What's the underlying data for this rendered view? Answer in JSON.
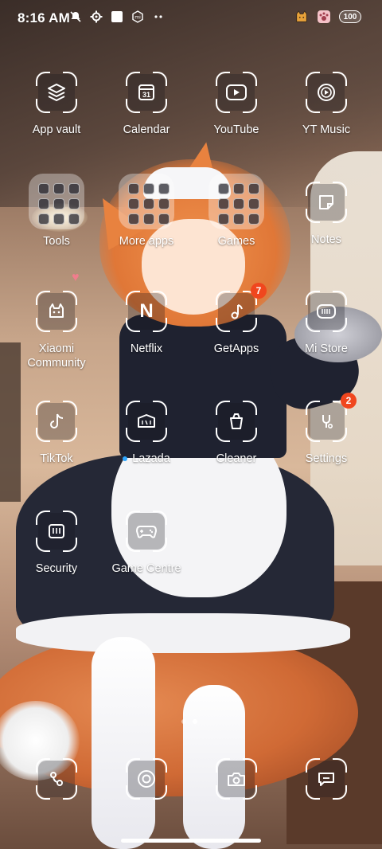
{
  "status_bar": {
    "time": "8:16 AM",
    "left_icons": [
      "mute-bell-icon",
      "gear-icon",
      "square-icon",
      "mi-icon",
      "more-dots-icon"
    ],
    "right_icons": [
      "cat-app-icon",
      "paw-app-icon"
    ],
    "battery": "100"
  },
  "apps": [
    {
      "label": "App vault",
      "icon": "layers-icon"
    },
    {
      "label": "Calendar",
      "icon": "calendar-icon",
      "glyph": "31"
    },
    {
      "label": "YouTube",
      "icon": "play-icon"
    },
    {
      "label": "YT Music",
      "icon": "music-play-icon"
    },
    {
      "label": "Tools",
      "icon": "folder-icon"
    },
    {
      "label": "More apps",
      "icon": "folder-icon"
    },
    {
      "label": "Games",
      "icon": "folder-icon"
    },
    {
      "label": "Notes",
      "icon": "note-icon"
    },
    {
      "label": "Xiaomi Community",
      "icon": "community-icon"
    },
    {
      "label": "Netflix",
      "icon": "netflix-icon",
      "glyph": "N"
    },
    {
      "label": "GetApps",
      "icon": "getapps-icon",
      "badge": "7"
    },
    {
      "label": "Mi Store",
      "icon": "store-icon"
    },
    {
      "label": "TikTok",
      "icon": "tiktok-icon"
    },
    {
      "label": "Lazada",
      "icon": "lazada-icon",
      "new_dot": true
    },
    {
      "label": "Cleaner",
      "icon": "cleaner-icon"
    },
    {
      "label": "Settings",
      "icon": "settings-icon",
      "badge": "2"
    },
    {
      "label": "Security",
      "icon": "security-icon"
    },
    {
      "label": "Game Centre",
      "icon": "gamepad-icon"
    }
  ],
  "dock": [
    {
      "icon": "phone-icon"
    },
    {
      "icon": "browser-icon"
    },
    {
      "icon": "camera-icon"
    },
    {
      "icon": "messages-icon"
    }
  ],
  "pager": {
    "pages": 2,
    "active": 2
  }
}
